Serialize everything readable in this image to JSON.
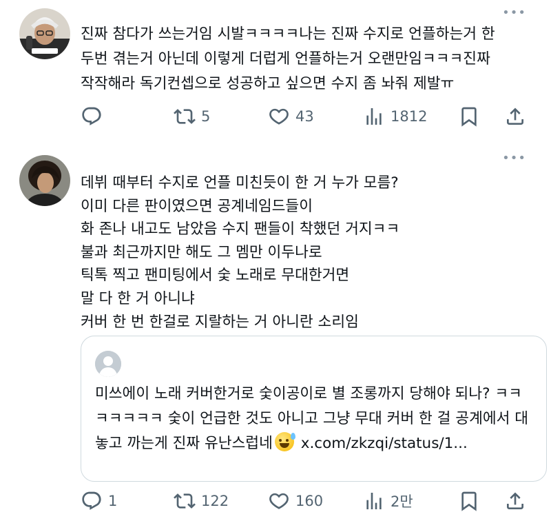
{
  "tweets": [
    {
      "text": "진짜 참다가 쓰는거임 시발ㅋㅋㅋㅋ나는 진짜 수지로 언플하는거 한\n두번 겪는거 아닌데 이렇게 더럽게 언플하는거 오랜만임ㅋㅋㅋ진짜\n작작해라 독기컨셉으로 성공하고 싶으면 수지 좀 놔줘 제발ㅠ",
      "replies": "",
      "retweets": "5",
      "likes": "43",
      "views": "1812"
    },
    {
      "text": "데뷔 때부터 수지로 언플 미친듯이 한 거 누가 모름?\n이미 다른 판이였으면 공계네임드들이\n화 존나 내고도 남았음 수지 팬들이 착했던 거지ㅋㅋ\n불과 최근까지만 해도 그 멤만 이두나로\n틱톡 찍고 팬미팅에서 숯 노래로 무대한거면\n말 다 한 거 아니냐\n커버 한 번 한걸로 지랄하는 거 아니란 소리임",
      "quote": {
        "text_before": "미쓰에이 노래 커버한거로 숯이공이로 별 조롱까지 당해야 되나? ㅋㅋㅋㅋㅋㅋㅋ 숯이 언급한 것도 아니고 그냥 무대 커버 한 걸 공계에서 대놓고 까는게 진짜 유난스럽네",
        "link": "x.com/zkzqi/status/1..."
      },
      "replies": "1",
      "retweets": "122",
      "likes": "160",
      "views": "2만"
    }
  ],
  "icons": {
    "reply": "reply-icon",
    "retweet": "retweet-icon",
    "like": "heart-icon",
    "views": "views-icon",
    "bookmark": "bookmark-icon",
    "share": "share-icon",
    "more": "more-icon"
  },
  "colors": {
    "icon": "#536471",
    "text": "#0f1419",
    "border": "#cfd9de"
  }
}
